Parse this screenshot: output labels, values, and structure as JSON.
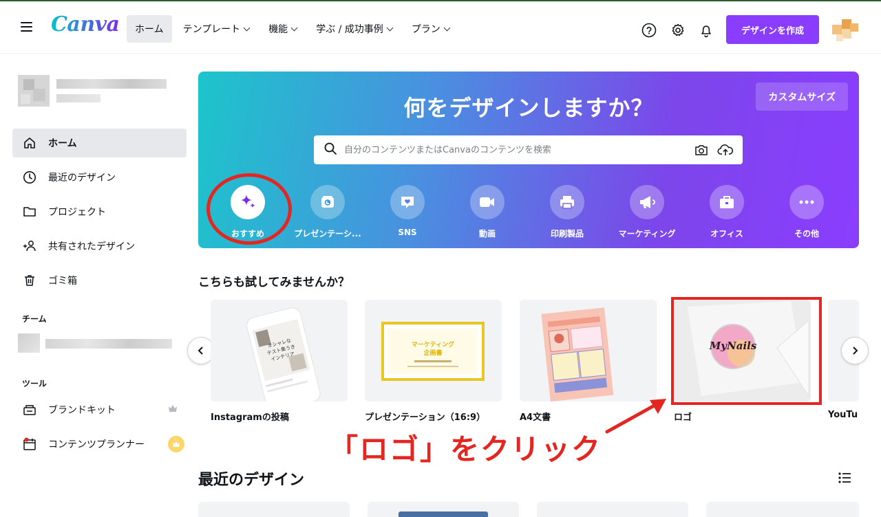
{
  "header": {
    "logo": "Canva",
    "nav": [
      {
        "label": "ホーム",
        "dropdown": false
      },
      {
        "label": "テンプレート",
        "dropdown": true
      },
      {
        "label": "機能",
        "dropdown": true
      },
      {
        "label": "学ぶ / 成功事例",
        "dropdown": true
      },
      {
        "label": "プラン",
        "dropdown": true
      }
    ],
    "create_button": "デザインを作成"
  },
  "sidebar": {
    "items": [
      {
        "label": "ホーム",
        "icon": "home-icon"
      },
      {
        "label": "最近のデザイン",
        "icon": "clock-icon"
      },
      {
        "label": "プロジェクト",
        "icon": "folder-icon"
      },
      {
        "label": "共有されたデザイン",
        "icon": "shared-users-icon"
      },
      {
        "label": "ゴミ箱",
        "icon": "trash-icon"
      }
    ],
    "team_heading": "チーム",
    "tools_heading": "ツール",
    "tools": [
      {
        "label": "ブランドキット",
        "icon": "brand-kit-icon"
      },
      {
        "label": "コンテンツプランナー",
        "icon": "calendar-icon"
      }
    ]
  },
  "hero": {
    "title": "何をデザインしますか？",
    "custom_size": "カスタムサイズ",
    "search_placeholder": "自分のコンテンツまたはCanvaのコンテンツを検索",
    "categories": [
      {
        "label": "おすすめ",
        "icon": "sparkle-icon"
      },
      {
        "label": "プレゼンテーシ...",
        "icon": "presentation-icon"
      },
      {
        "label": "SNS",
        "icon": "heart-chat-icon"
      },
      {
        "label": "動画",
        "icon": "video-camera-icon"
      },
      {
        "label": "印刷製品",
        "icon": "printer-icon"
      },
      {
        "label": "マーケティング",
        "icon": "megaphone-icon"
      },
      {
        "label": "オフィス",
        "icon": "briefcase-icon"
      },
      {
        "label": "その他",
        "icon": "more-dots-icon"
      }
    ]
  },
  "suggestions": {
    "title": "こちらも試してみませんか？",
    "cards": [
      {
        "label": "Instagramの投稿",
        "thumb_text": "オシャレなテスト集うきインテリア"
      },
      {
        "label": "プレゼンテーション（16:9）",
        "thumb_text": "マーケティング企画書"
      },
      {
        "label": "A4文書",
        "thumb_text": ""
      },
      {
        "label": "ロゴ",
        "thumb_text": "MyNails"
      },
      {
        "label": "YouTu",
        "thumb_text": ""
      }
    ]
  },
  "annotation": "「ロゴ」をクリック",
  "recent": {
    "title": "最近のデザイン"
  },
  "colors": {
    "brand_purple": "#8b3dff",
    "annotation_red": "#e5251f",
    "hero_start": "#1cc5cb",
    "hero_end": "#8b3dff"
  }
}
